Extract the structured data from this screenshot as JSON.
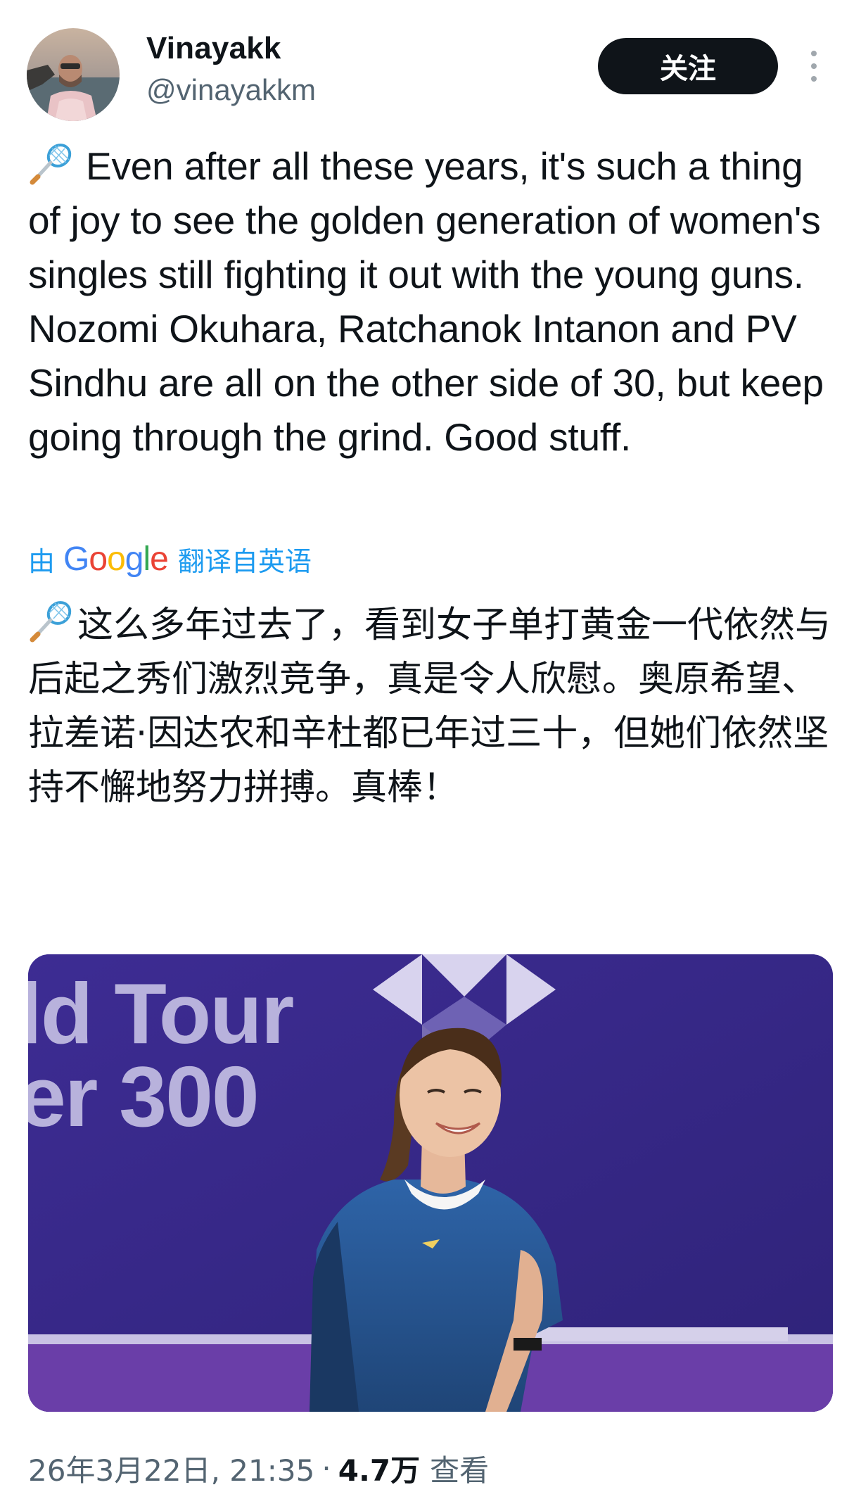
{
  "author": {
    "display_name": "Vinayakk",
    "handle": "@vinayakkm"
  },
  "follow_label": "关注",
  "more_icon": "more-vertical-icon",
  "tweet": {
    "emoji": "badminton-racket-icon",
    "text": "Even after all these years, it's such a thing of joy to see the golden generation of women's singles still fighting it out with the young guns. Nozomi Okuhara, Ratchanok Intanon and PV Sindhu are all on the other side of 30, but keep going through the grind. Good stuff."
  },
  "translation": {
    "by_label": "由",
    "provider": "Google",
    "from_label": "翻译自英语",
    "text": "这么多年过去了，看到女子单打黄金一代依然与后起之秀们激烈竞争，真是令人欣慰。奥原希望、拉差诺·因达农和辛杜都已年过三十，但她们依然坚持不懈地努力拼搏。真棒！"
  },
  "media": {
    "text_line_1": "ld Tour",
    "text_line_2": "er 300"
  },
  "meta": {
    "timestamp": "26年3月22日, 21:35",
    "separator": "·",
    "views_count": "4.7万",
    "views_label": "查看"
  },
  "colors": {
    "link_blue": "#1d9bf0",
    "text_primary": "#0f1419",
    "text_secondary": "#536471",
    "button_dark": "#0f1419"
  }
}
